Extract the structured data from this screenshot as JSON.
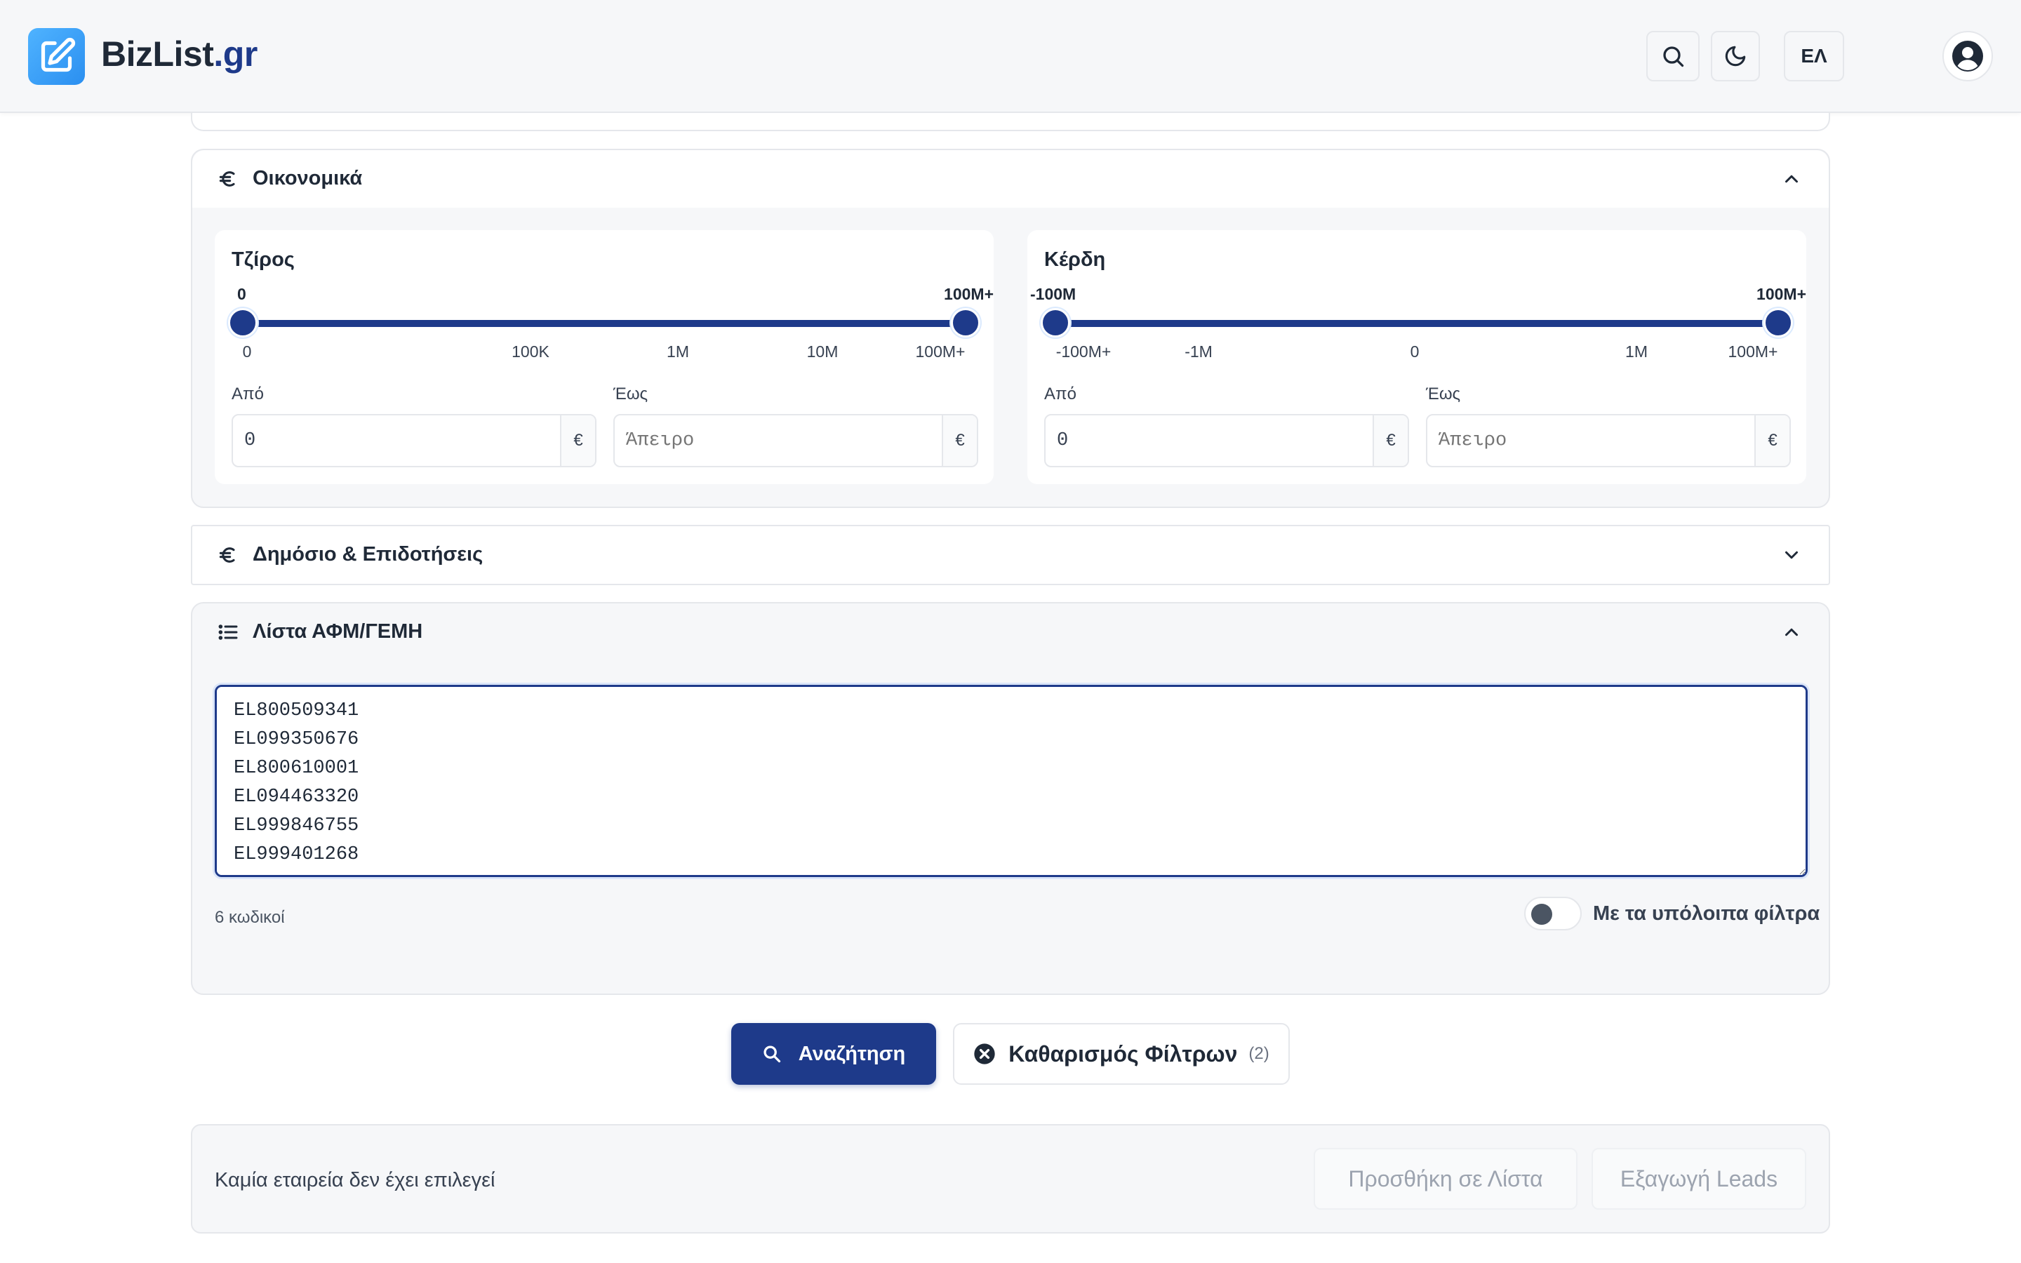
{
  "header": {
    "brand_name": "BizList",
    "brand_tld": ".gr",
    "language_label": "ΕΛ",
    "icons": {
      "logo": "edit-square-icon",
      "search": "search-icon",
      "theme": "moon-icon",
      "account": "user-circle-icon"
    }
  },
  "financials": {
    "title": "Οικονομικά",
    "icon": "euro-icon",
    "expanded": true,
    "turnover": {
      "title": "Τζίρος",
      "range_min_label": "0",
      "range_max_label": "100M+",
      "ticks": [
        "0",
        "100K",
        "1M",
        "10M",
        "100M+"
      ],
      "from_label": "Από",
      "from_value": "0",
      "to_label": "Έως",
      "to_placeholder": "Άπειρο",
      "currency": "€"
    },
    "profit": {
      "title": "Κέρδη",
      "range_min_label": "-100M",
      "range_max_label": "100M+",
      "ticks": [
        "-100M+",
        "-1M",
        "0",
        "1M",
        "100M+"
      ],
      "from_label": "Από",
      "from_value": "0",
      "to_label": "Έως",
      "to_placeholder": "Άπειρο",
      "currency": "€"
    }
  },
  "public_subsidies": {
    "title": "Δημόσιο & Επιδοτήσεις",
    "icon": "euro-icon",
    "expanded": false
  },
  "tax_id_list": {
    "title": "Λίστα ΑΦΜ/ΓΕΜΗ",
    "icon": "list-icon",
    "expanded": true,
    "codes_text": "EL800509341\nEL099350676\nEL800610001\nEL094463320\nEL999846755\nEL999401268",
    "count_label": "6 κωδικοί",
    "combine_label": "Με τα υπόλοιπα φίλτρα",
    "combine_enabled": false
  },
  "actions": {
    "search_label": "Αναζήτηση",
    "clear_label": "Καθαρισμός Φίλτρων",
    "clear_count": "(2)"
  },
  "selection_bar": {
    "status_text": "Καμία εταιρεία δεν έχει επιλεγεί",
    "add_to_list_label": "Προσθήκη σε Λίστα",
    "export_label": "Εξαγωγή Leads"
  },
  "colors": {
    "accent": "#1e3a8a",
    "header_bg": "#f6f7f9",
    "logo_gradient_start": "#4fb3ff",
    "logo_gradient_end": "#2b8ff0"
  }
}
